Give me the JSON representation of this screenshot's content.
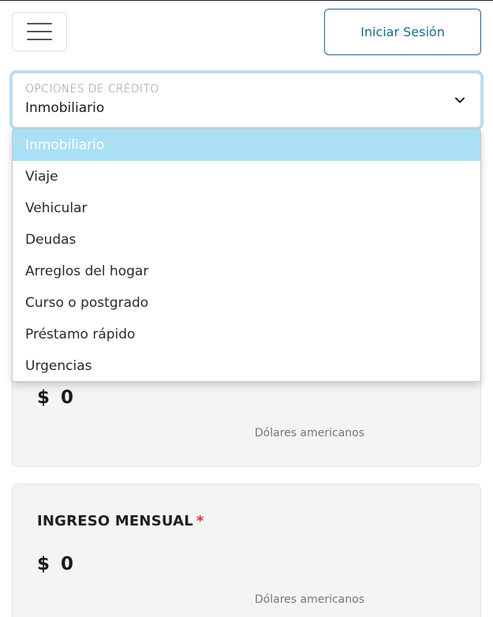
{
  "header": {
    "login_label": "Iniciar Sesión"
  },
  "credit_select": {
    "label": "OPCIONES DE CRÉDITO",
    "selected_value": "Inmobiliario",
    "options": [
      "Inmobiliario",
      "Viaje",
      "Vehicular",
      "Deudas",
      "Arreglos del hogar",
      "Curso o postgrado",
      "Préstamo rápido",
      "Urgencias"
    ],
    "highlighted_index": 0
  },
  "amount_card": {
    "currency_symbol": "$",
    "value": "0",
    "currency_note": "Dólares americanos"
  },
  "income_card": {
    "title": "INGRESO MENSUAL",
    "required_mark": "*",
    "currency_symbol": "$",
    "value": "0",
    "currency_note": "Dólares americanos"
  },
  "colors": {
    "accent": "#1a6b8a",
    "focus_ring": "#b8dcf5",
    "highlight": "#abdff5",
    "required": "#d9333f",
    "card_bg": "#f4f4f4"
  }
}
